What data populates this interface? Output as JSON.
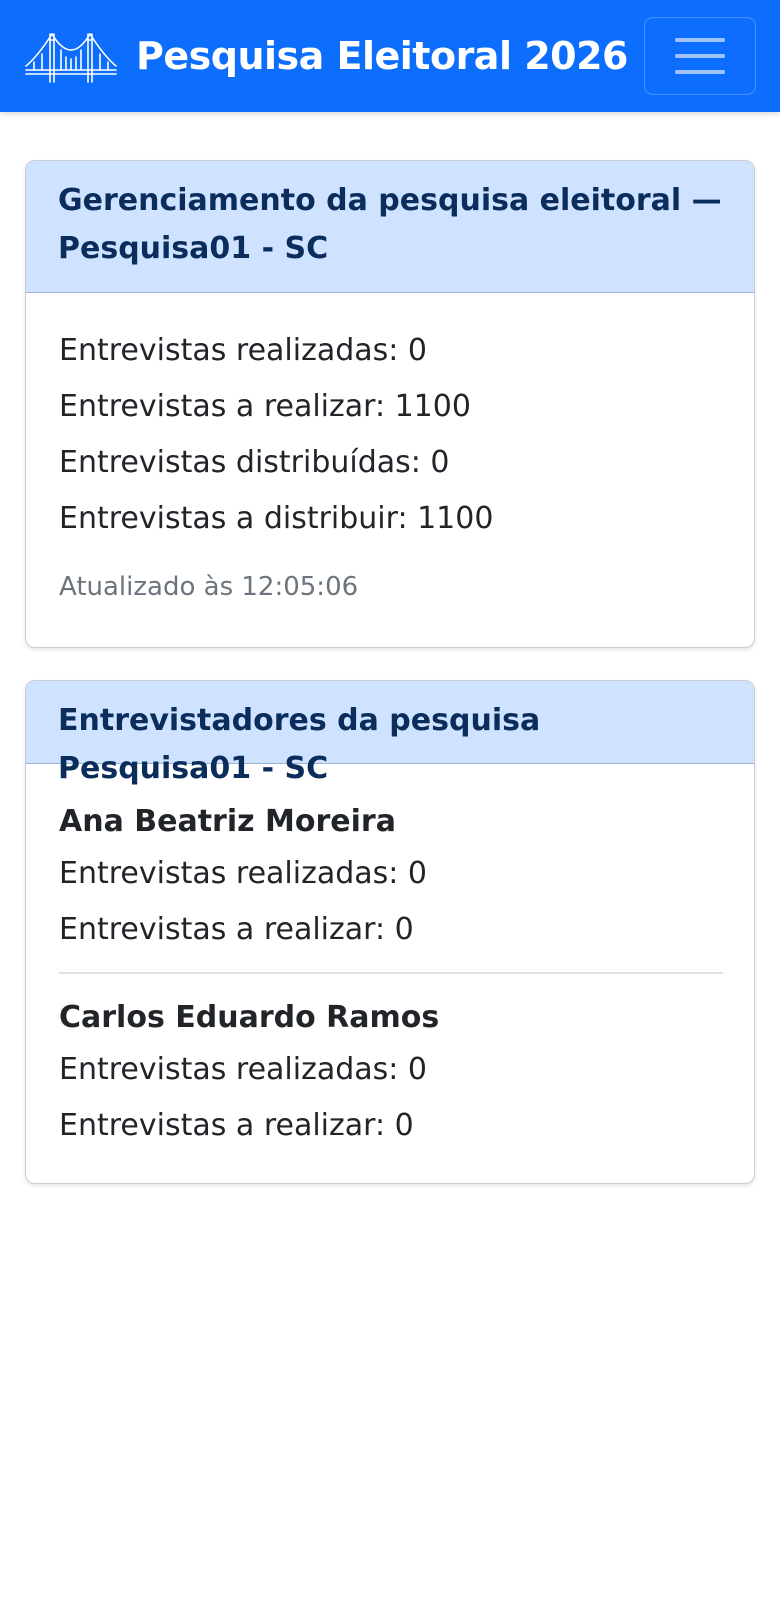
{
  "navbar": {
    "title": "Pesquisa Eleitoral 2026",
    "logo_icon": "bridge-logo-icon",
    "menu_icon": "hamburger-menu-icon"
  },
  "management_card": {
    "title": "Gerenciamento da pesquisa eleitoral — Pesquisa01 - SC",
    "stats": [
      "Entrevistas realizadas: 0",
      "Entrevistas a realizar: 1100",
      "Entrevistas distribuídas: 0",
      "Entrevistas a distribuir: 1100"
    ],
    "updated": "Atualizado às 12:05:06"
  },
  "interviewers_card": {
    "title": "Entrevistadores da pesquisa Pesquisa01 - SC",
    "interviewers": [
      {
        "name": "Ana Beatriz Moreira",
        "done": "Entrevistas realizadas: 0",
        "todo": "Entrevistas a realizar: 0"
      },
      {
        "name": "Carlos Eduardo Ramos",
        "done": "Entrevistas realizadas: 0",
        "todo": "Entrevistas a realizar: 0"
      }
    ]
  },
  "colors": {
    "primary": "#0d6efd",
    "header_bg": "#cfe2ff",
    "header_text": "#0a2d5c",
    "muted": "#6c757d"
  }
}
